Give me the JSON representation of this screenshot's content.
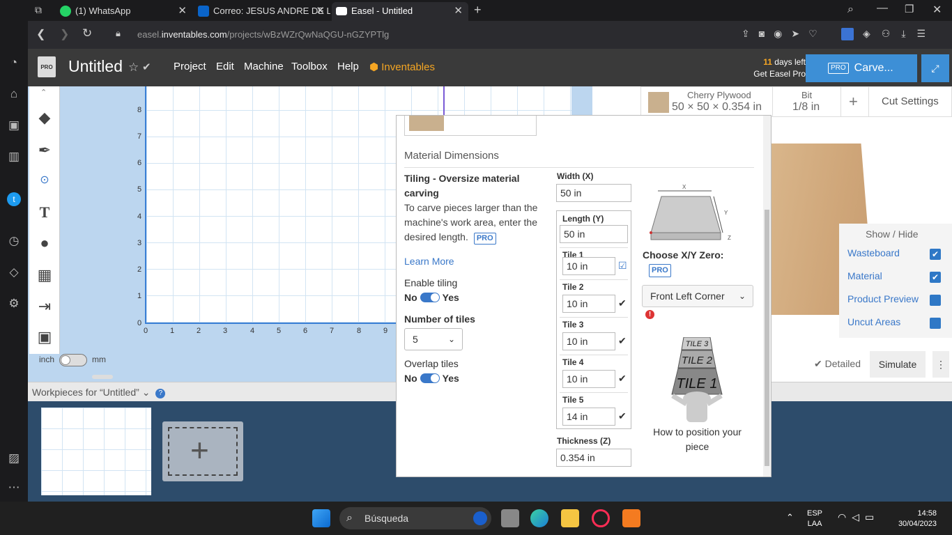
{
  "browser": {
    "tabs": [
      {
        "label": "(1) WhatsApp",
        "color": "#25d366"
      },
      {
        "label": "Correo: JESUS ANDRE DE L",
        "color": "#0a64c9"
      },
      {
        "label": "Easel - Untitled",
        "color": "#ffffff"
      }
    ],
    "new_tab": "+",
    "url_prefix": "easel.",
    "url_domain": "inventables.com",
    "url_path": "/projects/wBzWZrQwNaQGU-nGZYPTlg"
  },
  "app": {
    "logo": "PRO",
    "title": "Untitled",
    "menu": [
      "Project",
      "Edit",
      "Machine",
      "Toolbox",
      "Help"
    ],
    "brand": "Inventables",
    "days_count": "11",
    "days_text": "days left",
    "get_pro": "Get Easel Pro",
    "carve_badge": "PRO",
    "carve_label": "Carve..."
  },
  "canvas": {
    "y_ticks": [
      "0",
      "1",
      "2",
      "3",
      "4",
      "5",
      "6",
      "7",
      "8"
    ],
    "x_ticks": [
      "0",
      "1",
      "2",
      "3",
      "4",
      "5",
      "6",
      "7",
      "8",
      "9"
    ],
    "unit_inch": "inch",
    "unit_mm": "mm"
  },
  "material_bar": {
    "name": "Cherry Plywood",
    "size": "50 × 50 × 0.354 in",
    "bit_label": "Bit",
    "bit_value": "1/8 in",
    "add": "+",
    "cut_settings": "Cut Settings"
  },
  "show_hide": {
    "title": "Show / Hide",
    "items": [
      {
        "label": "Wasteboard",
        "checked": true
      },
      {
        "label": "Material",
        "checked": true
      },
      {
        "label": "Product Preview",
        "checked": false
      },
      {
        "label": "Uncut Areas",
        "checked": false
      }
    ]
  },
  "sim": {
    "detailed": "Detailed",
    "simulate": "Simulate"
  },
  "workpieces": {
    "title": "Workpieces for “Untitled”"
  },
  "modal": {
    "section_title": "Material Dimensions",
    "tiling_heading": "Tiling - Oversize material carving",
    "tiling_desc": "To carve pieces larger than the machine's work area, enter the desired length.",
    "pro": "PRO",
    "learn_more": "Learn More",
    "enable_tiling": "Enable tiling",
    "no": "No",
    "yes": "Yes",
    "num_tiles_label": "Number of tiles",
    "num_tiles_value": "5",
    "overlap_tiles": "Overlap tiles",
    "width_label": "Width (X)",
    "width_value": "50 in",
    "length_label": "Length (Y)",
    "length_value": "50 in",
    "tiles": [
      {
        "label": "Tile 1",
        "value": "10 in"
      },
      {
        "label": "Tile 2",
        "value": "10 in"
      },
      {
        "label": "Tile 3",
        "value": "10 in"
      },
      {
        "label": "Tile 4",
        "value": "10 in"
      },
      {
        "label": "Tile 5",
        "value": "14 in"
      }
    ],
    "thickness_label": "Thickness (Z)",
    "thickness_value": "0.354 in",
    "diagram_x": "X",
    "diagram_y": "Y",
    "diagram_z": "Z",
    "xy_zero_label": "Choose X/Y Zero:",
    "xy_zero_value": "Front Left Corner",
    "tile_img": [
      "TILE 3",
      "TILE 2",
      "TILE 1"
    ],
    "howto": "How to position your piece"
  },
  "taskbar": {
    "search": "Búsqueda",
    "lang1": "ESP",
    "lang2": "LAA",
    "time": "14:58",
    "date": "30/04/2023"
  }
}
